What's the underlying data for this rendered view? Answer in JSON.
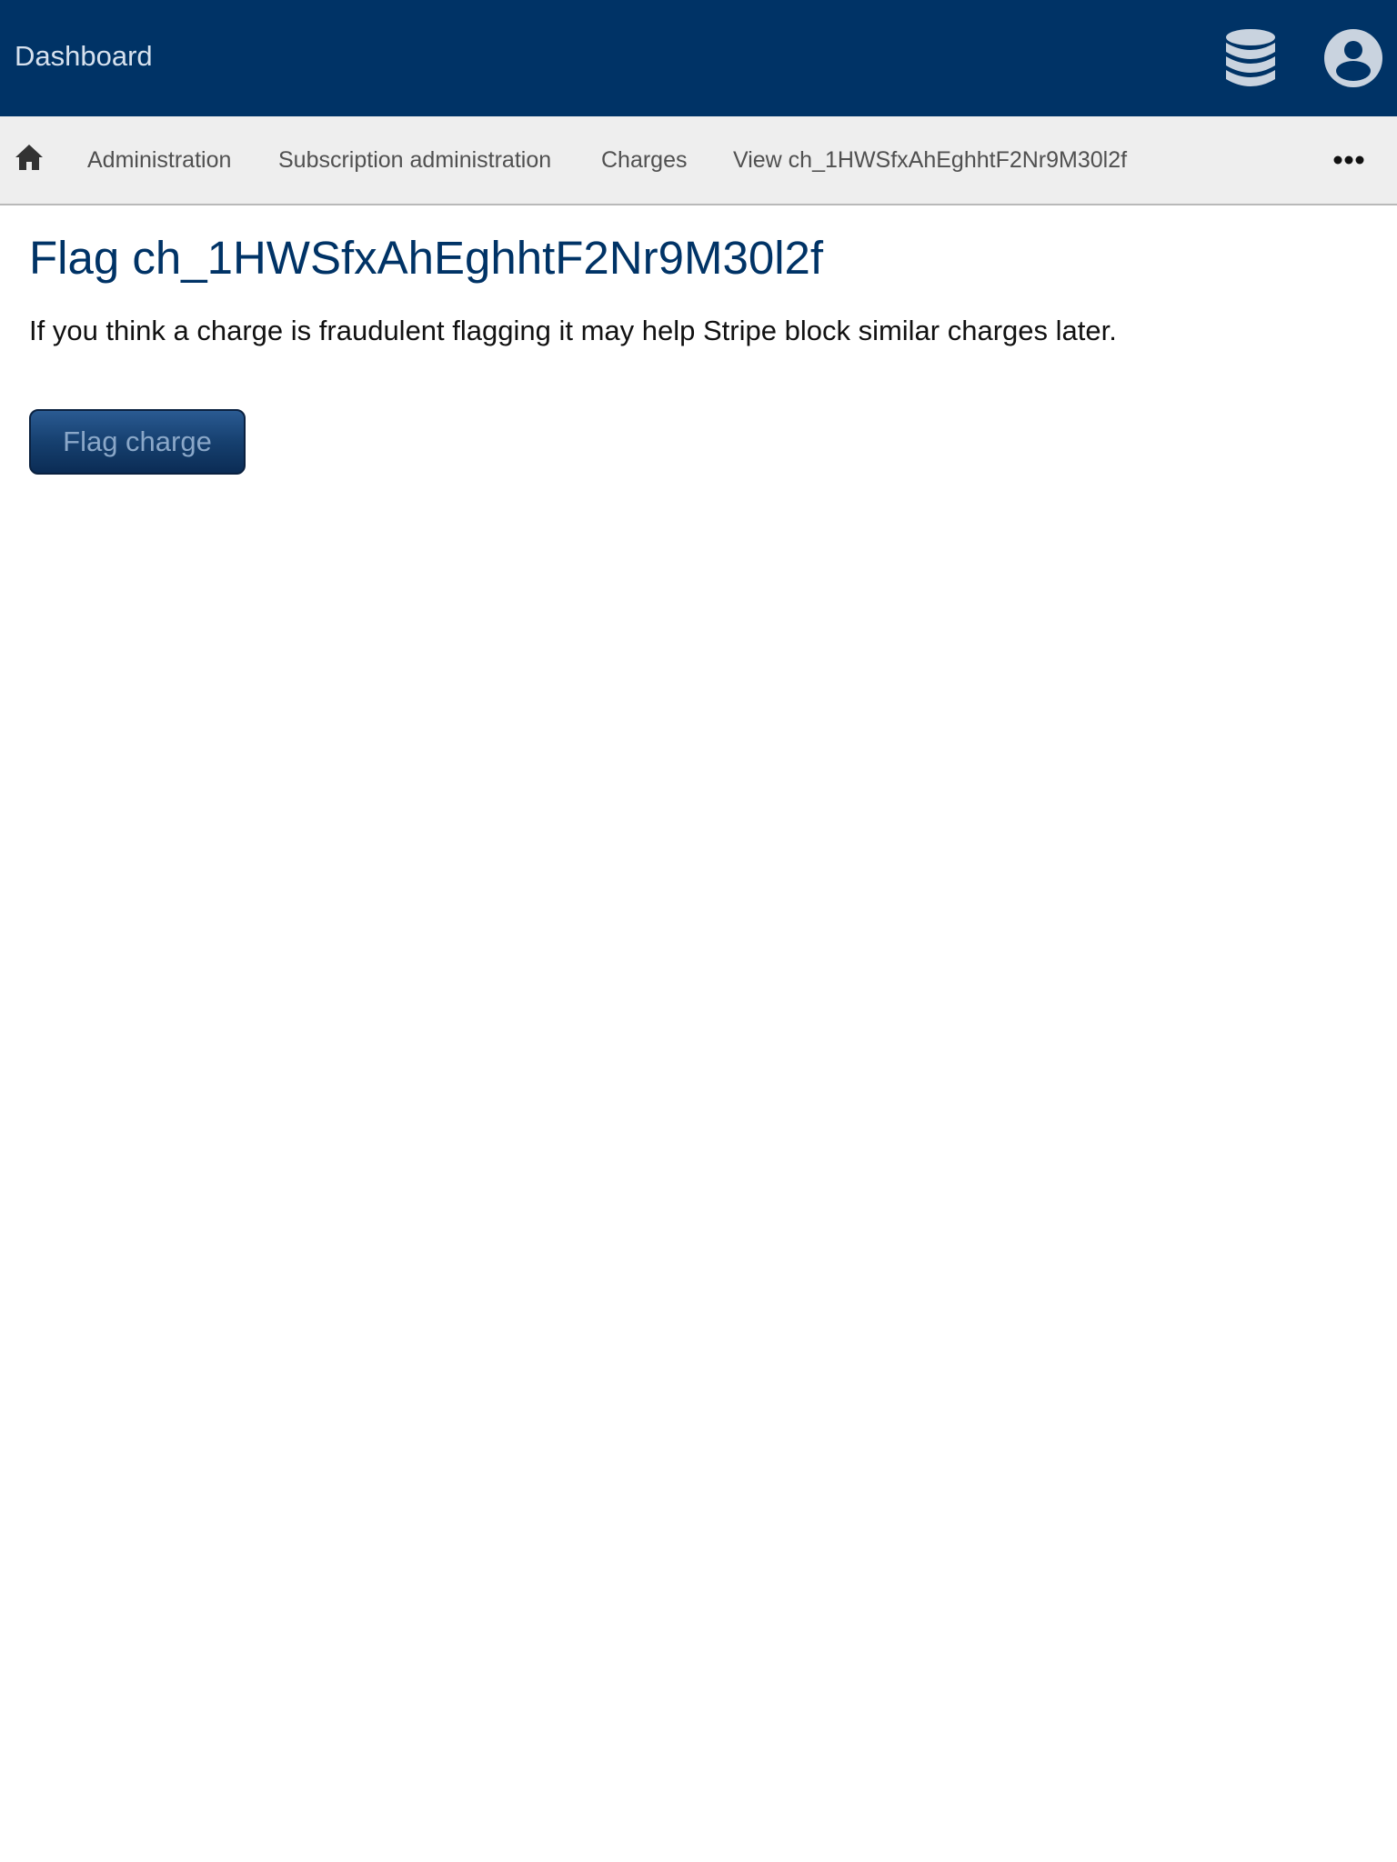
{
  "header": {
    "brand_label": "Dashboard",
    "background_color": "#003366",
    "icons": [
      "database-icon",
      "user-account-icon"
    ]
  },
  "breadcrumb": {
    "home_icon": "home-icon",
    "items": [
      {
        "label": "Administration"
      },
      {
        "label": "Subscription administration"
      },
      {
        "label": "Charges"
      },
      {
        "label": "View ch_1HWSfxAhEghhtF2Nr9M30l2f"
      }
    ],
    "more_icon": "ellipsis-icon"
  },
  "main": {
    "title": "Flag ch_1HWSfxAhEghhtF2Nr9M30l2f",
    "description": "If you think a charge is fraudulent flagging it may help Stripe block similar charges later.",
    "flag_button_label": "Flag charge"
  }
}
